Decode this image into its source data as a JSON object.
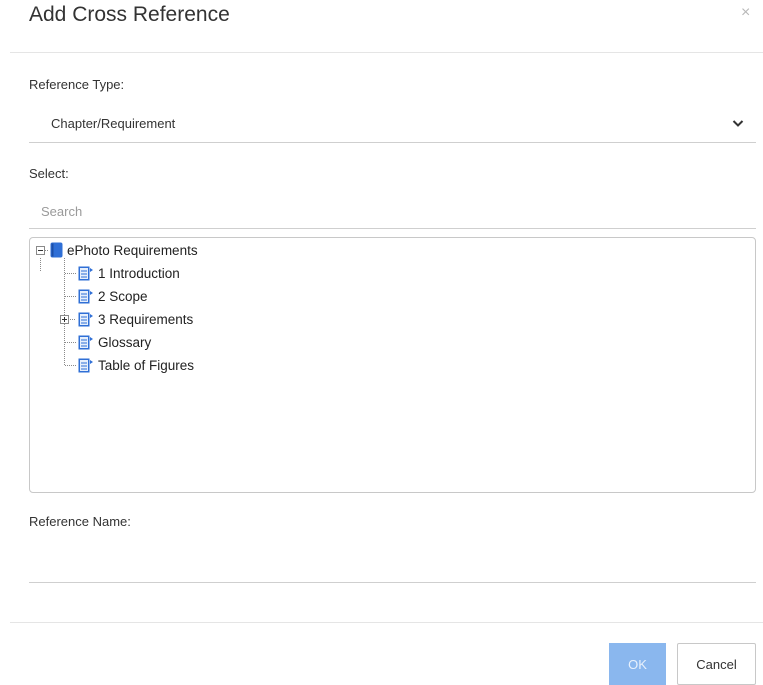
{
  "dialog": {
    "title": "Add Cross Reference",
    "close_icon": "close-icon",
    "close_glyph": "×"
  },
  "reference_type": {
    "label": "Reference Type:",
    "selected": "Chapter/Requirement"
  },
  "select": {
    "label": "Select:",
    "search_placeholder": "Search"
  },
  "tree": {
    "root": {
      "label": "ePhoto Requirements",
      "icon": "book-icon",
      "expanded": true
    },
    "children": [
      {
        "label": "1 Introduction",
        "icon": "document-icon",
        "expandable": false
      },
      {
        "label": "2 Scope",
        "icon": "document-icon",
        "expandable": false
      },
      {
        "label": "3 Requirements",
        "icon": "document-icon",
        "expandable": true
      },
      {
        "label": "Glossary",
        "icon": "document-icon",
        "expandable": false
      },
      {
        "label": "Table of Figures",
        "icon": "document-icon",
        "expandable": false
      }
    ]
  },
  "reference_name": {
    "label": "Reference Name:",
    "value": ""
  },
  "buttons": {
    "ok": "OK",
    "cancel": "Cancel"
  },
  "colors": {
    "accent_disabled": "#8ab7ee",
    "icon_blue": "#2f6fd6"
  }
}
